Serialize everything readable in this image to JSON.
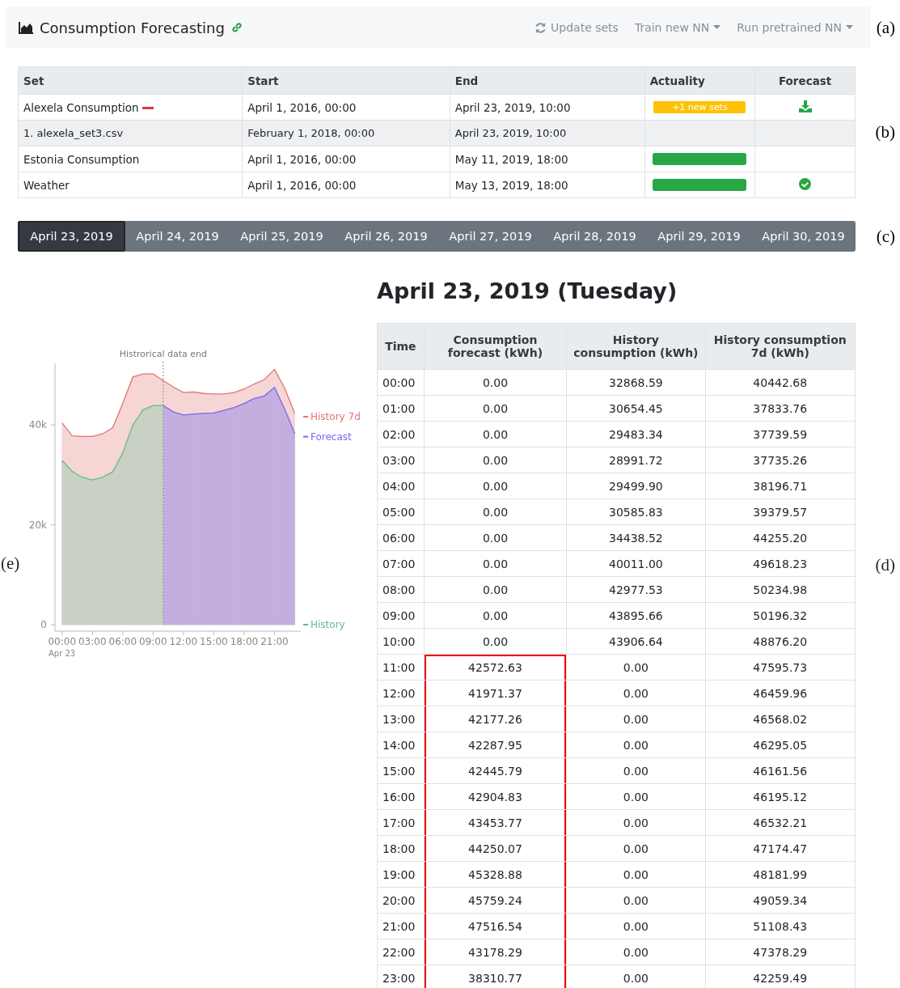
{
  "header": {
    "title": "Consumption Forecasting",
    "actions": [
      {
        "label": "Update sets",
        "kind": "refresh"
      },
      {
        "label": "Train new NN",
        "kind": "dropdown"
      },
      {
        "label": "Run pretrained NN",
        "kind": "dropdown"
      }
    ],
    "panel_label": "(a)"
  },
  "sets": {
    "panel_label": "(b)",
    "columns": [
      "Set",
      "Start",
      "End",
      "Actuality",
      "Forecast"
    ],
    "rows": [
      {
        "name": "Alexela Consumption",
        "start": "April 1, 2016, 00:00",
        "end": "April 23, 2019, 10:00",
        "expanded": true,
        "actuality": {
          "kind": "badge",
          "text": "+1 new sets"
        },
        "forecast": {
          "kind": "download"
        },
        "children": [
          {
            "name": "1. alexela_set3.csv",
            "start": "February 1, 2018, 00:00",
            "end": "April 23, 2019, 10:00"
          }
        ]
      },
      {
        "name": "Estonia Consumption",
        "start": "April 1, 2016, 00:00",
        "end": "May 11, 2019, 18:00",
        "actuality": {
          "kind": "bar"
        }
      },
      {
        "name": "Weather",
        "start": "April 1, 2016, 00:00",
        "end": "May 13, 2019, 18:00",
        "actuality": {
          "kind": "bar"
        },
        "forecast": {
          "kind": "check"
        }
      }
    ]
  },
  "date_tabs": {
    "panel_label": "(c)",
    "tabs": [
      {
        "label": "April 23, 2019",
        "selected": true
      },
      {
        "label": "April 24, 2019",
        "selected": false
      },
      {
        "label": "April 25, 2019",
        "selected": false
      },
      {
        "label": "April 26, 2019",
        "selected": false
      },
      {
        "label": "April 27, 2019",
        "selected": false
      },
      {
        "label": "April 28, 2019",
        "selected": false
      },
      {
        "label": "April 29, 2019",
        "selected": false
      },
      {
        "label": "April 30, 2019",
        "selected": false
      }
    ]
  },
  "chart": {
    "panel_label": "(e)",
    "date_label": "Apr 23",
    "chart_data": {
      "type": "area",
      "x": [
        0,
        1,
        2,
        3,
        4,
        5,
        6,
        7,
        8,
        9,
        10,
        11,
        12,
        13,
        14,
        15,
        16,
        17,
        18,
        19,
        20,
        21,
        22,
        23
      ],
      "xlim": [
        -0.7,
        23.6
      ],
      "legend": "right",
      "ylim": [
        0,
        52500
      ],
      "yticks": [
        {
          "value": 0,
          "label": "0"
        },
        {
          "value": 20000,
          "label": "20k"
        },
        {
          "value": 40000,
          "label": "40k"
        }
      ],
      "xticks": [
        {
          "value": 0,
          "label": "00:00"
        },
        {
          "value": 3,
          "label": "03:00"
        },
        {
          "value": 6,
          "label": "06:00"
        },
        {
          "value": 9,
          "label": "09:00"
        },
        {
          "value": 12,
          "label": "12:00"
        },
        {
          "value": 15,
          "label": "15:00"
        },
        {
          "value": 18,
          "label": "18:00"
        },
        {
          "value": 21,
          "label": "21:00"
        }
      ],
      "annotations": [
        {
          "x": 10,
          "text": "Histrorical data end"
        }
      ],
      "series": [
        {
          "name": "History 7d",
          "color": "#e57373",
          "values": [
            40400,
            37800,
            37700,
            37700,
            38200,
            39400,
            44300,
            49600,
            50200,
            50200,
            48900,
            47600,
            46500,
            46600,
            46300,
            46200,
            46200,
            46500,
            47200,
            48200,
            49100,
            51100,
            47400,
            42300
          ]
        },
        {
          "name": "Forecast",
          "color": "#7b68ee",
          "values": [
            null,
            null,
            null,
            null,
            null,
            null,
            null,
            null,
            null,
            null,
            43900,
            42600,
            42000,
            42200,
            42300,
            42400,
            42900,
            43500,
            44300,
            45300,
            45800,
            47500,
            43200,
            38300
          ]
        },
        {
          "name": "History",
          "color": "#66bb8a",
          "values": [
            32900,
            30700,
            29500,
            29000,
            29500,
            30600,
            34400,
            40000,
            43000,
            43900,
            43900,
            null,
            null,
            null,
            null,
            null,
            null,
            null,
            null,
            null,
            null,
            null,
            null,
            null
          ]
        }
      ]
    }
  },
  "day": {
    "panel_label": "(d)",
    "title": "April 23, 2019 (Tuesday)",
    "columns": [
      "Time",
      "Consumption forecast (kWh)",
      "History consumption (kWh)",
      "History consumption 7d (kWh)"
    ],
    "rows": [
      {
        "time": "00:00",
        "forecast": "0.00",
        "history": "32868.59",
        "history_7d": "40442.68",
        "highlighted": false
      },
      {
        "time": "01:00",
        "forecast": "0.00",
        "history": "30654.45",
        "history_7d": "37833.76",
        "highlighted": false
      },
      {
        "time": "02:00",
        "forecast": "0.00",
        "history": "29483.34",
        "history_7d": "37739.59",
        "highlighted": false
      },
      {
        "time": "03:00",
        "forecast": "0.00",
        "history": "28991.72",
        "history_7d": "37735.26",
        "highlighted": false
      },
      {
        "time": "04:00",
        "forecast": "0.00",
        "history": "29499.90",
        "history_7d": "38196.71",
        "highlighted": false
      },
      {
        "time": "05:00",
        "forecast": "0.00",
        "history": "30585.83",
        "history_7d": "39379.57",
        "highlighted": false
      },
      {
        "time": "06:00",
        "forecast": "0.00",
        "history": "34438.52",
        "history_7d": "44255.20",
        "highlighted": false
      },
      {
        "time": "07:00",
        "forecast": "0.00",
        "history": "40011.00",
        "history_7d": "49618.23",
        "highlighted": false
      },
      {
        "time": "08:00",
        "forecast": "0.00",
        "history": "42977.53",
        "history_7d": "50234.98",
        "highlighted": false
      },
      {
        "time": "09:00",
        "forecast": "0.00",
        "history": "43895.66",
        "history_7d": "50196.32",
        "highlighted": false
      },
      {
        "time": "10:00",
        "forecast": "0.00",
        "history": "43906.64",
        "history_7d": "48876.20",
        "highlighted": false
      },
      {
        "time": "11:00",
        "forecast": "42572.63",
        "history": "0.00",
        "history_7d": "47595.73",
        "highlighted": true
      },
      {
        "time": "12:00",
        "forecast": "41971.37",
        "history": "0.00",
        "history_7d": "46459.96",
        "highlighted": true
      },
      {
        "time": "13:00",
        "forecast": "42177.26",
        "history": "0.00",
        "history_7d": "46568.02",
        "highlighted": true
      },
      {
        "time": "14:00",
        "forecast": "42287.95",
        "history": "0.00",
        "history_7d": "46295.05",
        "highlighted": true
      },
      {
        "time": "15:00",
        "forecast": "42445.79",
        "history": "0.00",
        "history_7d": "46161.56",
        "highlighted": true
      },
      {
        "time": "16:00",
        "forecast": "42904.83",
        "history": "0.00",
        "history_7d": "46195.12",
        "highlighted": true
      },
      {
        "time": "17:00",
        "forecast": "43453.77",
        "history": "0.00",
        "history_7d": "46532.21",
        "highlighted": true
      },
      {
        "time": "18:00",
        "forecast": "44250.07",
        "history": "0.00",
        "history_7d": "47174.47",
        "highlighted": true
      },
      {
        "time": "19:00",
        "forecast": "45328.88",
        "history": "0.00",
        "history_7d": "48181.99",
        "highlighted": true
      },
      {
        "time": "20:00",
        "forecast": "45759.24",
        "history": "0.00",
        "history_7d": "49059.34",
        "highlighted": true
      },
      {
        "time": "21:00",
        "forecast": "47516.54",
        "history": "0.00",
        "history_7d": "51108.43",
        "highlighted": true
      },
      {
        "time": "22:00",
        "forecast": "43178.29",
        "history": "0.00",
        "history_7d": "47378.29",
        "highlighted": true
      },
      {
        "time": "23:00",
        "forecast": "38310.77",
        "history": "0.00",
        "history_7d": "42259.49",
        "highlighted": true
      }
    ]
  }
}
